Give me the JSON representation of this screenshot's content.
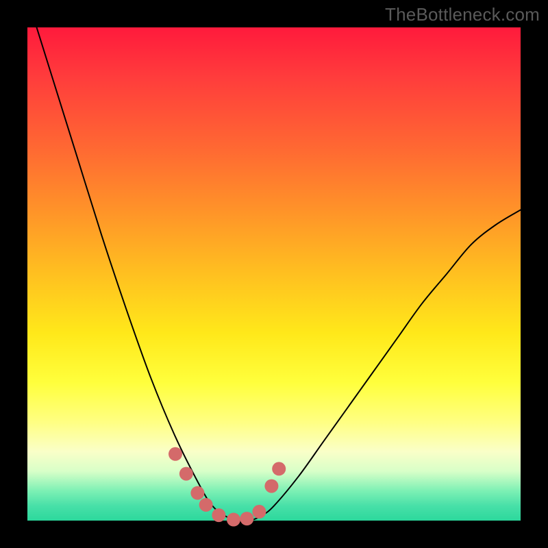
{
  "watermark": "TheBottleneck.com",
  "chart_data": {
    "type": "line",
    "title": "",
    "xlabel": "",
    "ylabel": "",
    "x": [
      0.0,
      0.05,
      0.1,
      0.15,
      0.2,
      0.25,
      0.3,
      0.35,
      0.375,
      0.4,
      0.425,
      0.45,
      0.475,
      0.5,
      0.55,
      0.6,
      0.65,
      0.7,
      0.75,
      0.8,
      0.85,
      0.9,
      0.95,
      1.0
    ],
    "values": [
      1.06,
      0.9,
      0.74,
      0.58,
      0.43,
      0.29,
      0.17,
      0.07,
      0.03,
      0.01,
      0.0,
      0.0,
      0.01,
      0.03,
      0.09,
      0.16,
      0.23,
      0.3,
      0.37,
      0.44,
      0.5,
      0.56,
      0.6,
      0.63
    ],
    "xlim": [
      0.0,
      1.0
    ],
    "ylim": [
      0.0,
      1.0
    ],
    "markers": {
      "color": "#d46a6a",
      "radius_px": 10,
      "points_xy": [
        [
          0.3,
          0.135
        ],
        [
          0.322,
          0.095
        ],
        [
          0.345,
          0.056
        ],
        [
          0.362,
          0.032
        ],
        [
          0.388,
          0.011
        ],
        [
          0.418,
          0.002
        ],
        [
          0.445,
          0.004
        ],
        [
          0.47,
          0.018
        ],
        [
          0.495,
          0.07
        ],
        [
          0.51,
          0.105
        ]
      ]
    }
  }
}
